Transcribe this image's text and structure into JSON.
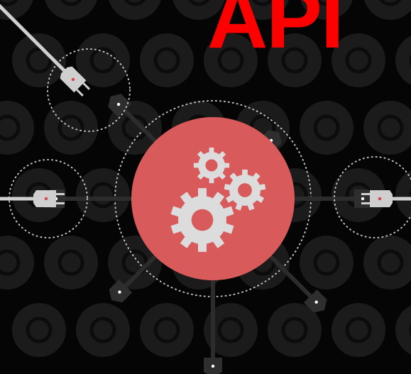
{
  "title": {
    "text": "API"
  },
  "colors": {
    "background": "#050505",
    "pattern_icon": "#1b1b1b",
    "hub": "#d95a5a",
    "gear": "#dcdcdc",
    "cable": "#2c2c2c",
    "socket": "#2e2e2e",
    "plug": "#cfcfcf",
    "dotted_ring": "#bfbfbf",
    "title": "#ff0000"
  },
  "illustration": {
    "hub_icon": "gears-icon",
    "connectors": [
      "top",
      "top-right",
      "right",
      "bottom-right",
      "bottom",
      "bottom-left",
      "left",
      "top-left"
    ],
    "plugged_in": [
      "top-left",
      "left",
      "right"
    ],
    "background_icons": [
      "lock-icon",
      "lightbulb-icon",
      "arrow-icon",
      "lightning-icon",
      "atom-icon",
      "fingerprint-icon",
      "gauge-icon"
    ]
  }
}
